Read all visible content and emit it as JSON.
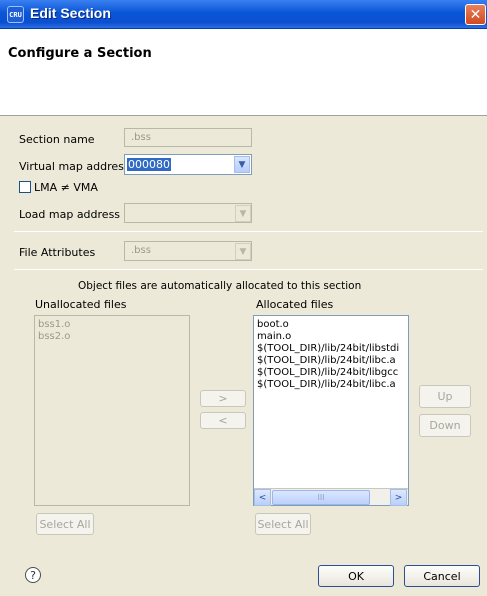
{
  "window": {
    "title": "Edit Section",
    "app_icon": "eclipse-app-icon",
    "close_glyph": "✕",
    "app_icon_text": "CRU"
  },
  "header": {
    "title": "Configure a Section"
  },
  "form": {
    "section_name_label": "Section name",
    "section_name_value": ".bss",
    "virtual_map_label": "Virtual map address",
    "virtual_map_value": "000080",
    "lma_label": "LMA ≠ VMA",
    "lma_checked": false,
    "load_map_label": "Load map address",
    "load_map_value": "",
    "file_attr_label": "File Attributes",
    "file_attr_value": ".bss"
  },
  "files": {
    "info": "Object files are automatically allocated to this section",
    "unallocated_label": "Unallocated files",
    "allocated_label": "Allocated files",
    "unallocated": [
      "bss1.o",
      "bss2.o"
    ],
    "allocated": [
      "boot.o",
      "main.o",
      "$(TOOL_DIR)/lib/24bit/libstdi",
      "$(TOOL_DIR)/lib/24bit/libc.a",
      "$(TOOL_DIR)/lib/24bit/libgcc",
      "$(TOOL_DIR)/lib/24bit/libc.a"
    ],
    "move_right_glyph": ">",
    "move_left_glyph": "<",
    "up_label": "Up",
    "down_label": "Down",
    "select_all_left": "Select All",
    "select_all_right": "Select All",
    "scroll_left_glyph": "<",
    "scroll_right_glyph": ">",
    "scroll_thumb_glyph": "III"
  },
  "footer": {
    "help_glyph": "?",
    "ok_label": "OK",
    "cancel_label": "Cancel"
  },
  "colors": {
    "titlebar": "#0a56d8",
    "dialog_bg": "#ece9d8",
    "selection": "#316ac5"
  }
}
